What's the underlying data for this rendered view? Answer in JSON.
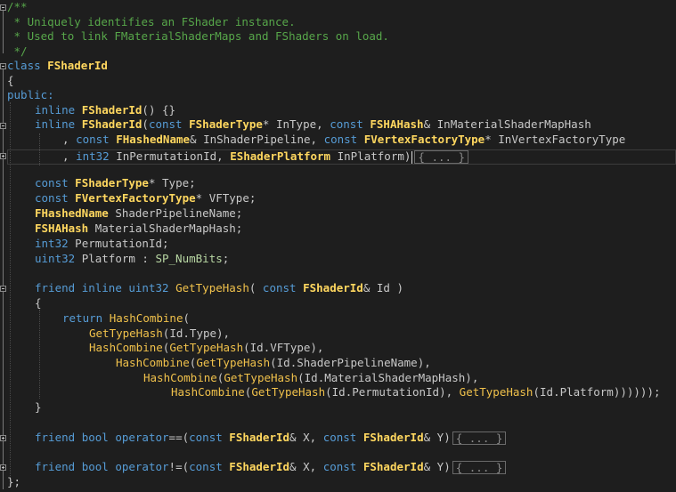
{
  "editor": {
    "collapsed_placeholder": "{ ... }",
    "lines": [
      "/**",
      " * Uniquely identifies an FShader instance.",
      " * Used to link FMaterialShaderMaps and FShaders on load.",
      " */",
      "class FShaderId",
      "{",
      "public:",
      "inline FShaderId() {}",
      "inline FShaderId(const FShaderType* InType, const FSHAHash& InMaterialShaderMapHash",
      ", const FHashedName& InShaderPipeline, const FVertexFactoryType* InVertexFactoryType",
      ", int32 InPermutationId, EShaderPlatform InPlatform)",
      "const FShaderType* Type;",
      "const FVertexFactoryType* VFType;",
      "FHashedName ShaderPipelineName;",
      "FSHAHash MaterialShaderMapHash;",
      "int32 PermutationId;",
      "uint32 Platform : SP_NumBits;",
      "friend inline uint32 GetTypeHash( const FShaderId& Id )",
      "{",
      "return HashCombine(",
      "GetTypeHash(Id.Type),",
      "HashCombine(GetTypeHash(Id.VFType),",
      "HashCombine(GetTypeHash(Id.ShaderPipelineName),",
      "HashCombine(GetTypeHash(Id.MaterialShaderMapHash),",
      "HashCombine(GetTypeHash(Id.PermutationId), GetTypeHash(Id.Platform))))));",
      "}",
      "friend bool operator==(const FShaderId& X, const FShaderId& Y)",
      "friend bool operator!=(const FShaderId& X, const FShaderId& Y)",
      "};"
    ]
  },
  "colors": {
    "background": "#1e1e1e",
    "comment": "#57a64a",
    "keyword": "#569cd6",
    "type": "#ffd75f",
    "function": "#f0c14b",
    "enum_member": "#b8d7a3",
    "plain": "#dcdcdc"
  },
  "icons": {
    "fold_expanded": "minus-box-icon",
    "fold_collapsed": "plus-box-icon"
  }
}
